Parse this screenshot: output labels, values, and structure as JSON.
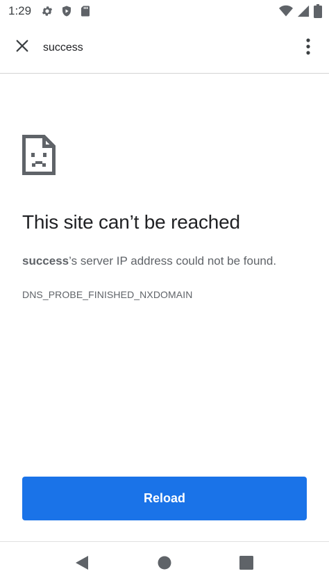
{
  "status_bar": {
    "time": "1:29",
    "icons": [
      "gear-icon",
      "shield-icon",
      "sd-card-icon",
      "wifi-icon",
      "signal-icon",
      "battery-icon"
    ]
  },
  "toolbar": {
    "title": "success",
    "close_icon": "close-icon",
    "menu_icon": "more-vert-icon"
  },
  "error": {
    "icon": "sad-page-icon",
    "title": "This site can’t be reached",
    "host": "success",
    "message_suffix": "’s server IP address could not be found.",
    "code": "DNS_PROBE_FINISHED_NXDOMAIN"
  },
  "reload_button": {
    "label": "Reload"
  },
  "nav_bar": {
    "icons": [
      "back-icon",
      "home-icon",
      "recents-icon"
    ]
  },
  "colors": {
    "accent": "#1a73e8",
    "text_primary": "#202124",
    "text_secondary": "#5f6368",
    "icon": "#5f6368"
  }
}
